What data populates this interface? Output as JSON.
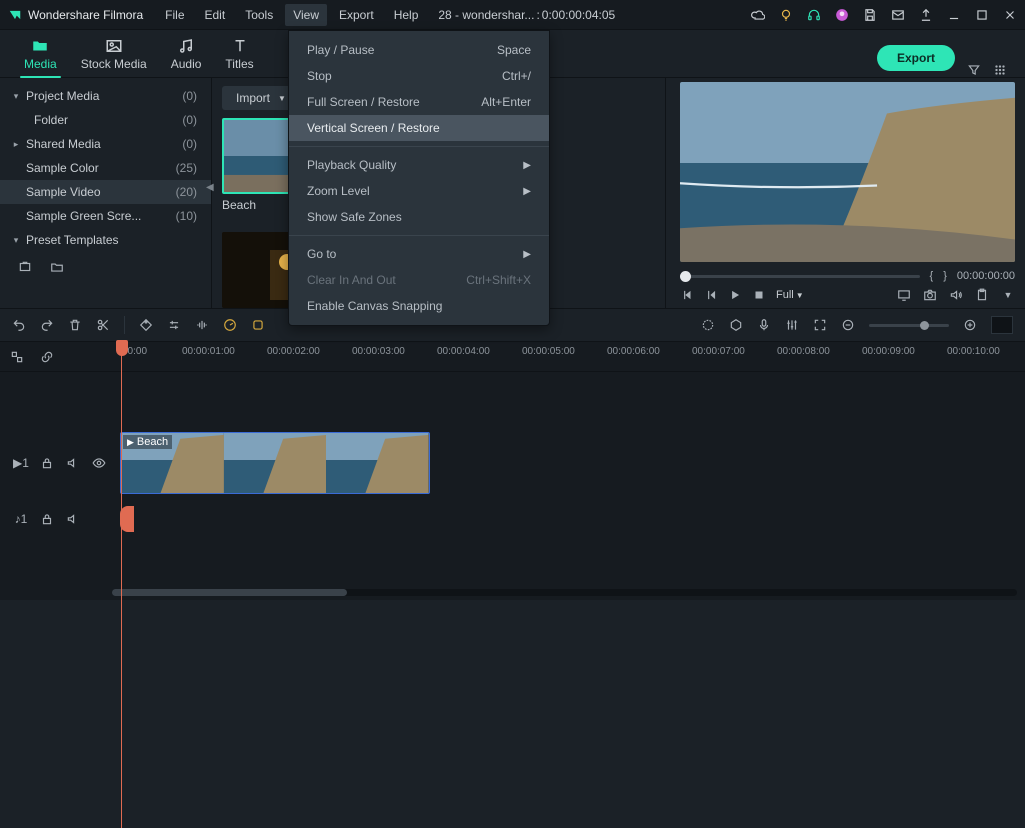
{
  "app": {
    "title": "Wondershare Filmora"
  },
  "menubar": [
    "File",
    "Edit",
    "Tools",
    "View",
    "Export",
    "Help"
  ],
  "project": {
    "label": "28 - wondershar...",
    "sep": " : ",
    "tc": "0:00:00:04:05"
  },
  "view_menu": {
    "items": [
      {
        "label": "Play / Pause",
        "shortcut": "Space"
      },
      {
        "label": "Stop",
        "shortcut": "Ctrl+/"
      },
      {
        "label": "Full Screen / Restore",
        "shortcut": "Alt+Enter"
      },
      {
        "label": "Vertical Screen / Restore",
        "shortcut": "",
        "hover": true
      },
      {
        "sep": true
      },
      {
        "label": "Playback Quality",
        "submenu": true
      },
      {
        "label": "Zoom Level",
        "submenu": true
      },
      {
        "label": "Show Safe Zones"
      },
      {
        "sep": true
      },
      {
        "label": "Go to",
        "submenu": true
      },
      {
        "label": "Clear In And Out",
        "shortcut": "Ctrl+Shift+X",
        "disabled": true
      },
      {
        "label": "Enable Canvas Snapping"
      }
    ]
  },
  "tabs": [
    {
      "label": "Media",
      "icon": "folder"
    },
    {
      "label": "Stock Media",
      "icon": "image"
    },
    {
      "label": "Audio",
      "icon": "music"
    },
    {
      "label": "Titles",
      "icon": "text"
    }
  ],
  "export_btn": "Export",
  "sidebar": {
    "items": [
      {
        "label": "Project Media",
        "count": "(0)",
        "chev": "▾"
      },
      {
        "label": "Folder",
        "count": "(0)",
        "chev": "",
        "indent": true
      },
      {
        "label": "Shared Media",
        "count": "(0)",
        "chev": "▸"
      },
      {
        "label": "Sample Color",
        "count": "(25)",
        "chev": ""
      },
      {
        "label": "Sample Video",
        "count": "(20)",
        "chev": "",
        "sel": true
      },
      {
        "label": "Sample Green Scre...",
        "count": "(10)",
        "chev": ""
      },
      {
        "label": "Preset Templates",
        "count": "",
        "chev": "▾"
      }
    ]
  },
  "import_label": "Import",
  "clip1_name": "Beach",
  "preview": {
    "mark_open": "{",
    "mark_close": "}",
    "time": "00:00:00:00",
    "full_label": "Full"
  },
  "ruler": {
    "labels": [
      "00:00",
      "00:00:01:00",
      "00:00:02:00",
      "00:00:03:00",
      "00:00:04:00",
      "00:00:05:00",
      "00:00:06:00",
      "00:00:07:00",
      "00:00:08:00",
      "00:00:09:00",
      "00:00:10:00"
    ]
  },
  "clip_in_track": "Beach"
}
